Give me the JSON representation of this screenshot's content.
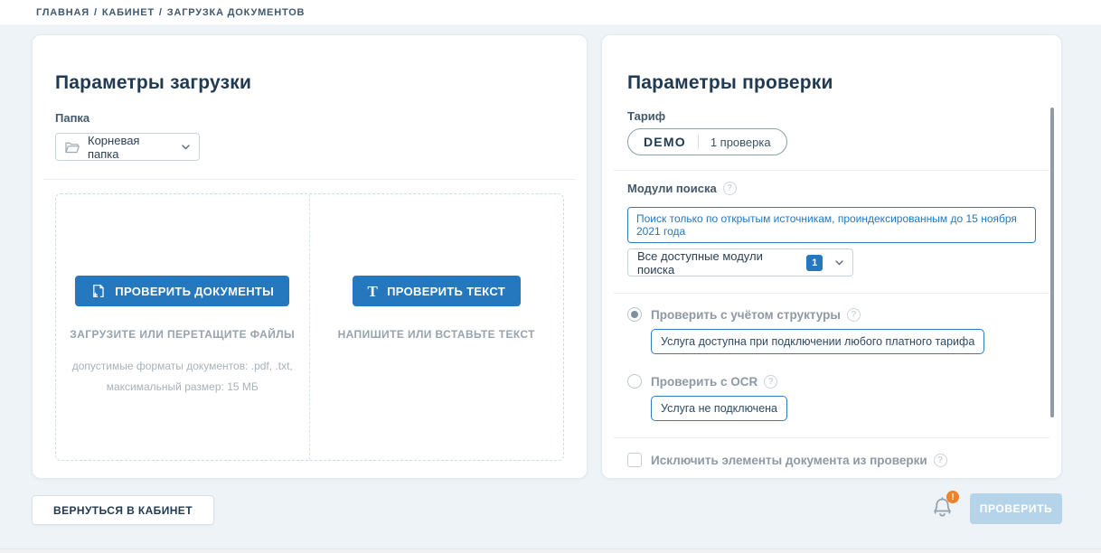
{
  "breadcrumb": {
    "items": [
      "ГЛАВНАЯ",
      "КАБИНЕТ",
      "ЗАГРУЗКА ДОКУМЕНТОВ"
    ],
    "separator": "/"
  },
  "upload_panel": {
    "title": "Параметры загрузки",
    "folder_label": "Папка",
    "folder_value": "Корневая папка",
    "documents": {
      "button": "ПРОВЕРИТЬ ДОКУМЕНТЫ",
      "hint": "ЗАГРУЗИТЕ ИЛИ ПЕРЕТАЩИТЕ ФАЙЛЫ",
      "formats": "допустимые форматы документов: .pdf, .txt, максимальный размер: 15 МБ"
    },
    "text": {
      "button": "ПРОВЕРИТЬ ТЕКСТ",
      "button_icon_glyph": "T",
      "hint": "НАПИШИТЕ ИЛИ ВСТАВЬТЕ ТЕКСТ"
    }
  },
  "check_panel": {
    "title": "Параметры проверки",
    "tariff_label": "Тариф",
    "tariff": {
      "name": "DEMO",
      "checks": "1 проверка"
    },
    "modules": {
      "label": "Модули поиска",
      "note": "Поиск только по открытым источникам, проиндексированным до 15 ноября 2021 года",
      "select_value": "Все доступные модули поиска",
      "selected_count": "1"
    },
    "options": [
      {
        "label": "Проверить с учётом структуры",
        "selected": true,
        "note": "Услуга доступна при подключении любого платного тарифа"
      },
      {
        "label": "Проверить с OCR",
        "selected": false,
        "note": "Услуга не подключена"
      }
    ],
    "exclude": {
      "label": "Исключить элементы документа из проверки",
      "checked": false
    }
  },
  "footer": {
    "back_button": "ВЕРНУТЬСЯ В КАБИНЕТ",
    "check_button": "ПРОВЕРИТЬ",
    "notification_badge": "!"
  },
  "icons": {
    "help_glyph": "?"
  },
  "colors": {
    "accent_blue": "#2577be",
    "heading_navy": "#203a52",
    "muted_gray": "#8d99a4",
    "notification_orange": "#f0832a",
    "disabled_button": "#b5d4ea",
    "page_background": "#edf3f7"
  }
}
